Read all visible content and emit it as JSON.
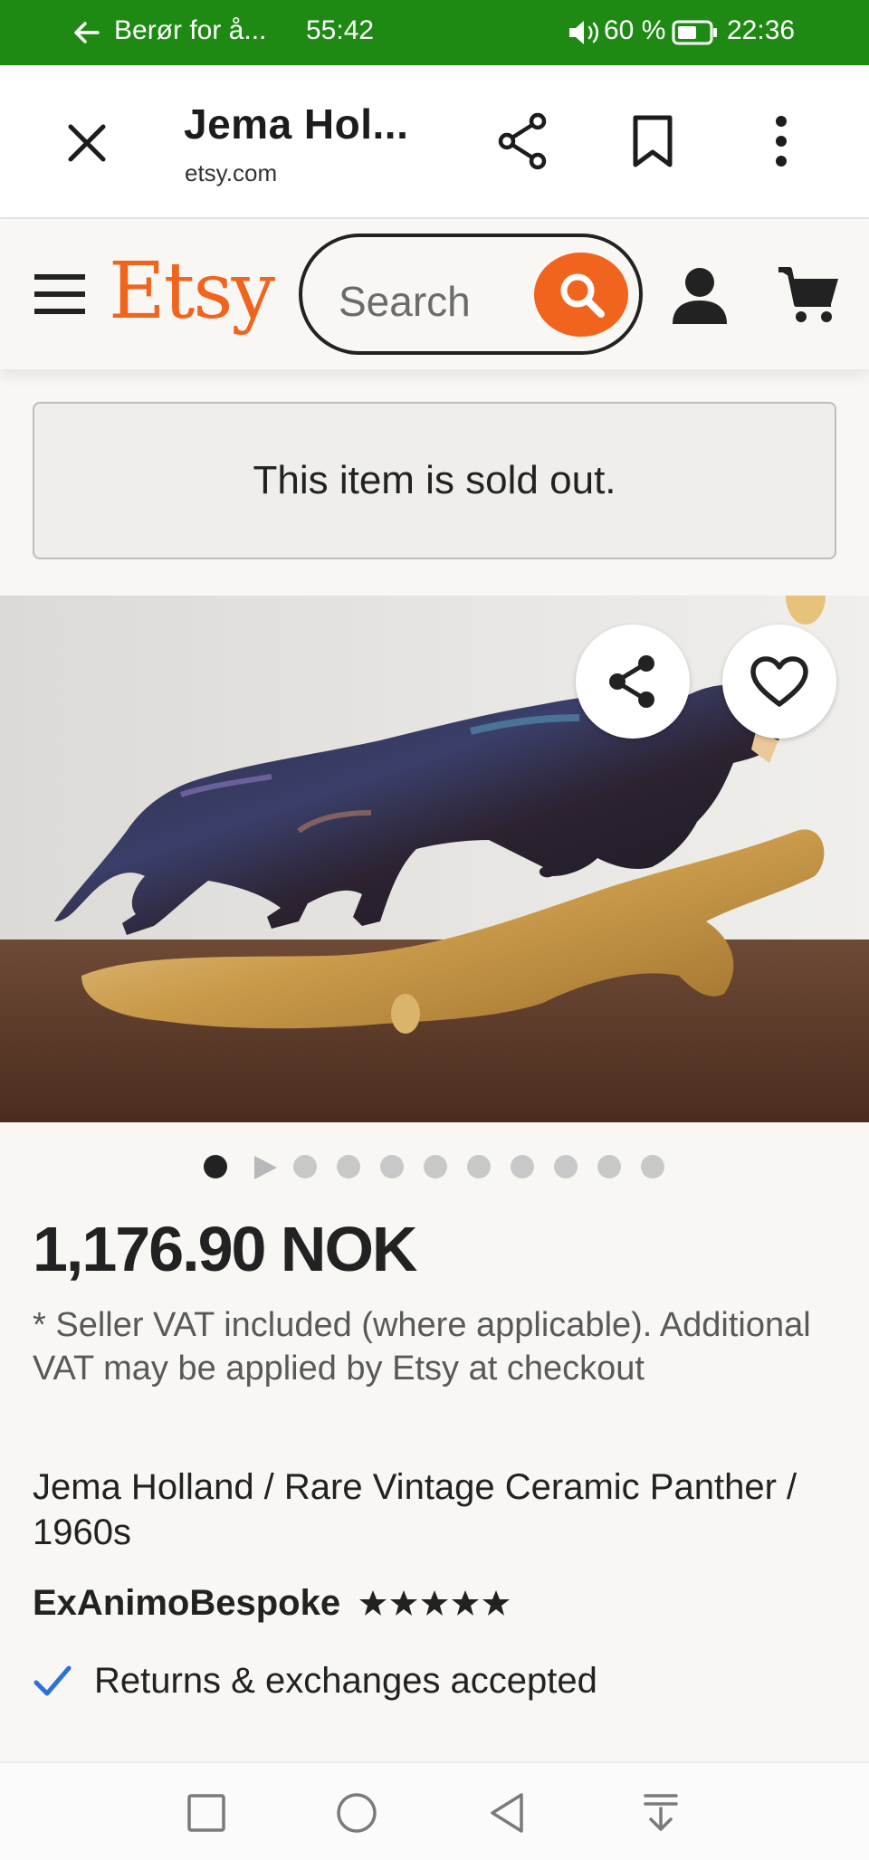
{
  "status_bar": {
    "notification": "Berør for å...",
    "timer": "55:42",
    "battery_percent": "60 %",
    "time": "22:36",
    "background_color": "#1e8a14"
  },
  "tab_toolbar": {
    "page_title": "Jema Hol...",
    "domain": "etsy.com",
    "icons": [
      "close-icon",
      "share-icon",
      "bookmark-icon",
      "more-vert-icon"
    ]
  },
  "etsy_header": {
    "logo_text": "Etsy",
    "search_placeholder": "Search",
    "brand_color": "#f1641e",
    "icons": [
      "hamburger-menu-icon",
      "search-icon",
      "user-icon",
      "cart-icon"
    ]
  },
  "notice": {
    "sold_out_text": "This item is sold out."
  },
  "gallery": {
    "image_subject": "ceramic-panther-on-branch",
    "total_slides": 11,
    "active_slide": 1,
    "second_item_is_video": true,
    "icons": [
      "share-icon",
      "heart-icon"
    ]
  },
  "listing": {
    "price": "1,176.90 NOK",
    "vat_note": "* Seller VAT included (where applicable). Additional VAT may be applied by Etsy at checkout",
    "title": "Jema Holland / Rare Vintage Ceramic Panther / 1960s",
    "shop_name": "ExAnimoBespoke",
    "rating_stars": 5,
    "returns_text": "Returns & exchanges accepted",
    "check_color": "#2f6fd8"
  },
  "nav_bar": {
    "icons": [
      "recent-apps-icon",
      "home-icon",
      "back-icon",
      "notification-pull-icon"
    ]
  }
}
